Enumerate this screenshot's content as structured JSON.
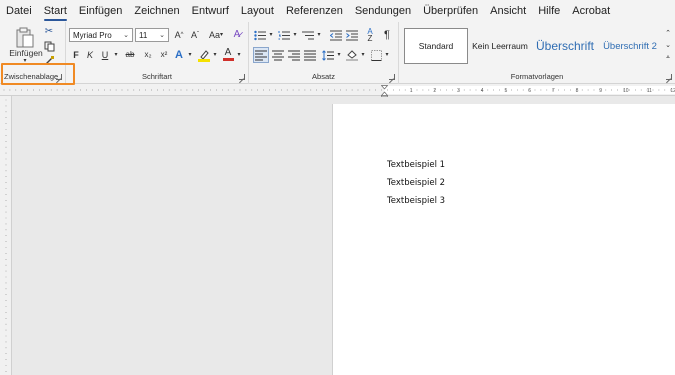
{
  "menu": [
    "Datei",
    "Start",
    "Einfügen",
    "Zeichnen",
    "Entwurf",
    "Layout",
    "Referenzen",
    "Sendungen",
    "Überprüfen",
    "Ansicht",
    "Hilfe",
    "Acrobat"
  ],
  "active_tab": "Start",
  "clipboard": {
    "paste_label": "Einfügen",
    "group_label": "Zwischenablage"
  },
  "font": {
    "family": "Myriad Pro",
    "size": "11",
    "group_label": "Schriftart",
    "bold": "F",
    "italic": "K",
    "underline": "U",
    "strike": "ab",
    "subscript": "x₂",
    "superscript": "x²",
    "grow": "A^",
    "shrink": "Aˇ",
    "case": "Aa",
    "text_effect": "A",
    "highlight": "ab",
    "font_color": "A"
  },
  "paragraph": {
    "group_label": "Absatz",
    "pilcrow": "¶"
  },
  "styles": {
    "group_label": "Formatvorlagen",
    "items": [
      "Standard",
      "Kein Leerraum",
      "Überschrift",
      "Überschrift 2"
    ]
  },
  "ruler_numbers": [
    "1",
    "2",
    "3",
    "4",
    "5",
    "6",
    "7",
    "8",
    "9",
    "10",
    "11",
    "12"
  ],
  "document": {
    "paragraphs": [
      "Textbeispiel 1",
      "Textbeispiel 2",
      "Textbeispiel 3"
    ]
  },
  "colors": {
    "accent": "#2b579a",
    "highlight_box": "#f08a24",
    "highlighter_yellow": "#f5e100",
    "font_red": "#d0302a"
  }
}
